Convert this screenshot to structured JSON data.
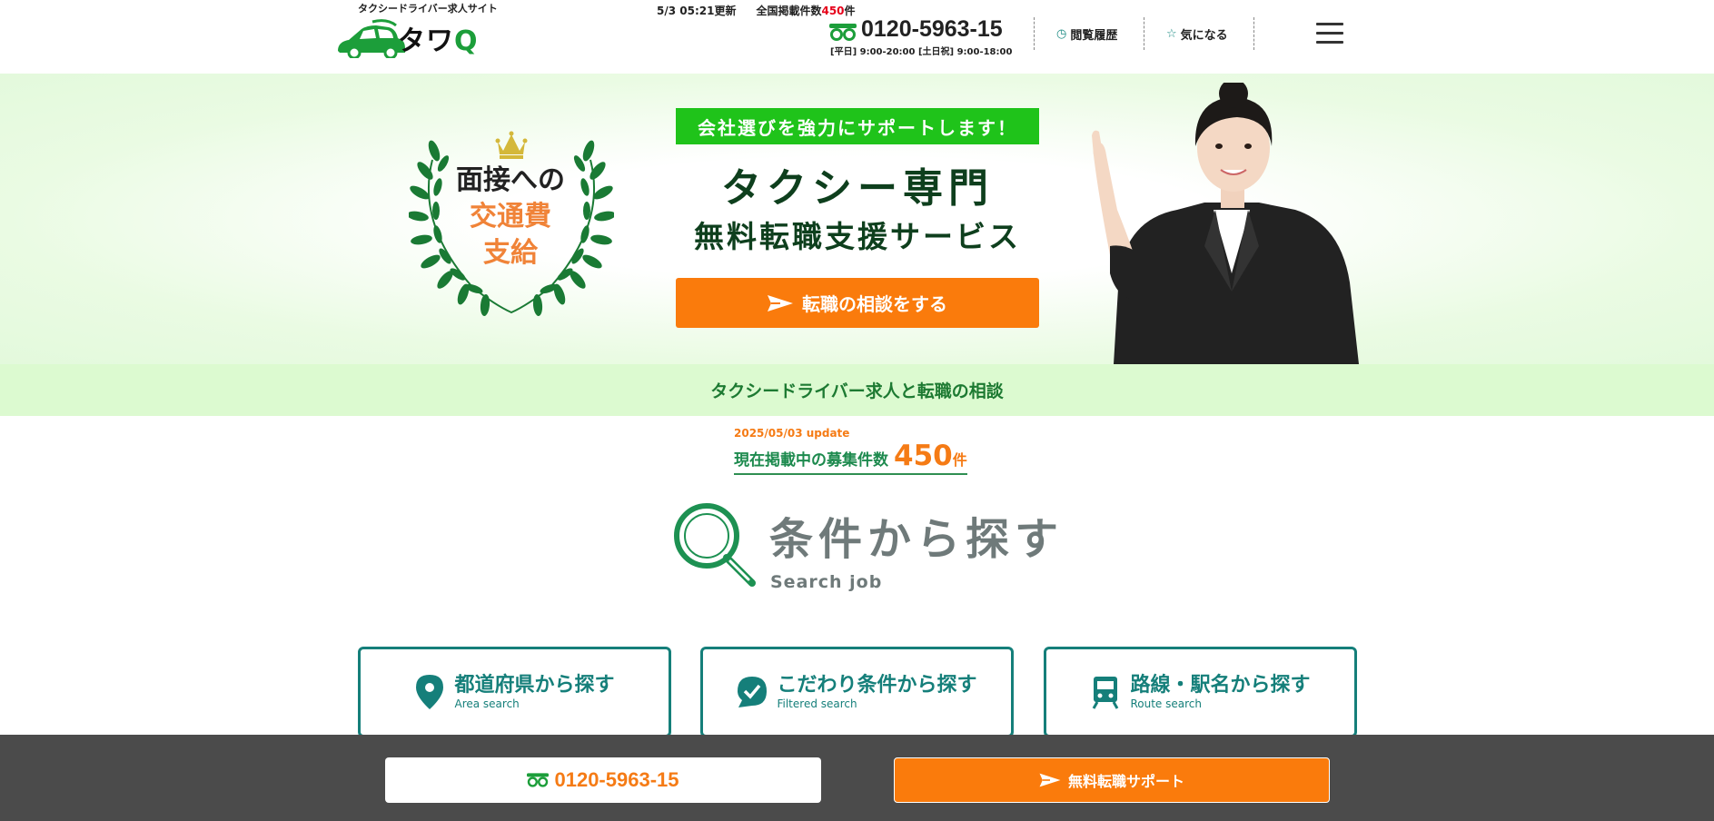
{
  "header": {
    "tagline": "タクシードライバー求人サイト",
    "logo_main": "タワ",
    "logo_q": "Q",
    "updated": "5/3 05:21更新",
    "listing_label": "全国掲載件数",
    "listing_count": "450",
    "listing_unit": "件",
    "phone": "0120-5963-15",
    "hours": "[平日] 9:00-20:00 [土日祝] 9:00-18:00",
    "history_label": "閲覧履歴",
    "favorite_label": "気になる"
  },
  "hero": {
    "badge_l1": "面接への",
    "badge_l2": "交通費",
    "badge_l3": "支給",
    "support_label": "会社選びを強力にサポートします！",
    "title_l1": "タクシー専門",
    "title_l2": "無料転職支援サービス",
    "cta_label": "転職の相談をする"
  },
  "band": {
    "label": "タクシードライバー求人と転職の相談"
  },
  "count": {
    "update_date": "2025/05/03 update",
    "label": "現在掲載中の募集件数",
    "number": "450",
    "unit": "件"
  },
  "search": {
    "title": "条件から探す",
    "subtitle": "Search job",
    "cards": [
      {
        "label": "都道府県から探す",
        "en": "Area search"
      },
      {
        "label": "こだわり条件から探す",
        "en": "Filtered search"
      },
      {
        "label": "路線・駅名から探す",
        "en": "Route search"
      }
    ]
  },
  "bottom": {
    "phone": "0120-5963-15",
    "support_label": "無料転職サポート"
  },
  "colors": {
    "brand_green": "#1c9e3a",
    "teal": "#157f7a",
    "orange": "#fa7b0c",
    "badge_green": "#1fc31a"
  }
}
